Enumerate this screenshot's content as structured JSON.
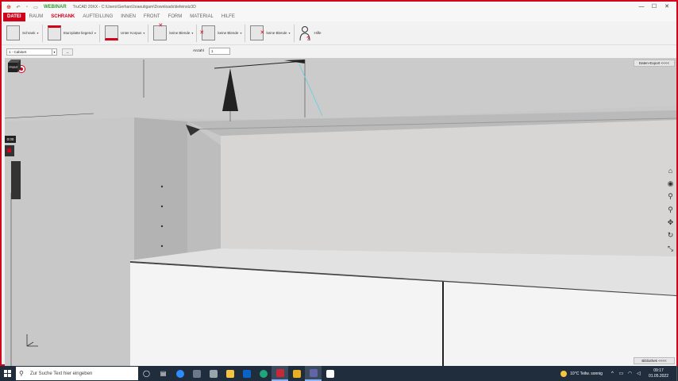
{
  "window": {
    "webinar_label": "WEBINAR",
    "title": "TruCAD 20XX - C:\\Users\\Gerhard.braeutigam\\Downloads\\tiefeinstz3D",
    "minimize": "—",
    "maximize": "☐",
    "close": "✕"
  },
  "menu": {
    "tabs": [
      "DATEI",
      "RAUM",
      "SCHRANK",
      "AUFTEILUNG",
      "INNEN",
      "FRONT",
      "FORM",
      "MATERIAL",
      "HILFE"
    ],
    "active": "SCHRANK"
  },
  "ribbon": {
    "items": [
      {
        "label": "Schrank",
        "caret": "▾"
      },
      {
        "label": "Sturzplatte liegend",
        "caret": "▾"
      },
      {
        "label": "Unter Korpus",
        "caret": "▾"
      },
      {
        "label": "keine Blende",
        "caret": "▾"
      },
      {
        "label": "keine Blende",
        "caret": "▾"
      },
      {
        "label": "keine Blende",
        "caret": "▾"
      },
      {
        "label": "Hilfe",
        "caret": ""
      }
    ]
  },
  "toolbar": {
    "cabinet_value": "1 - Cabinet",
    "arrow_btn": "→",
    "anzahl_label": "Anzahl",
    "anzahl_value": "1"
  },
  "viewport": {
    "export_label": "Daten-Export <<<<",
    "library_label": "Bibliothek <<<<",
    "cube_label": "FRONT",
    "timer": "0:00",
    "nav_icons": [
      "home-icon",
      "orbit-icon",
      "zoom-window-icon",
      "zoom-icon",
      "pan-icon",
      "rotate-icon",
      "fit-icon"
    ]
  },
  "taskbar": {
    "search_placeholder": "Zur Suche Text hier eingeben",
    "weather": "10°C  Teilw. sonnig",
    "time": "09:17",
    "date": "01.05.2022"
  },
  "colors": {
    "accent": "#d0021b",
    "webinar": "#2e9e2e",
    "taskbar": "#1f2d3d"
  }
}
